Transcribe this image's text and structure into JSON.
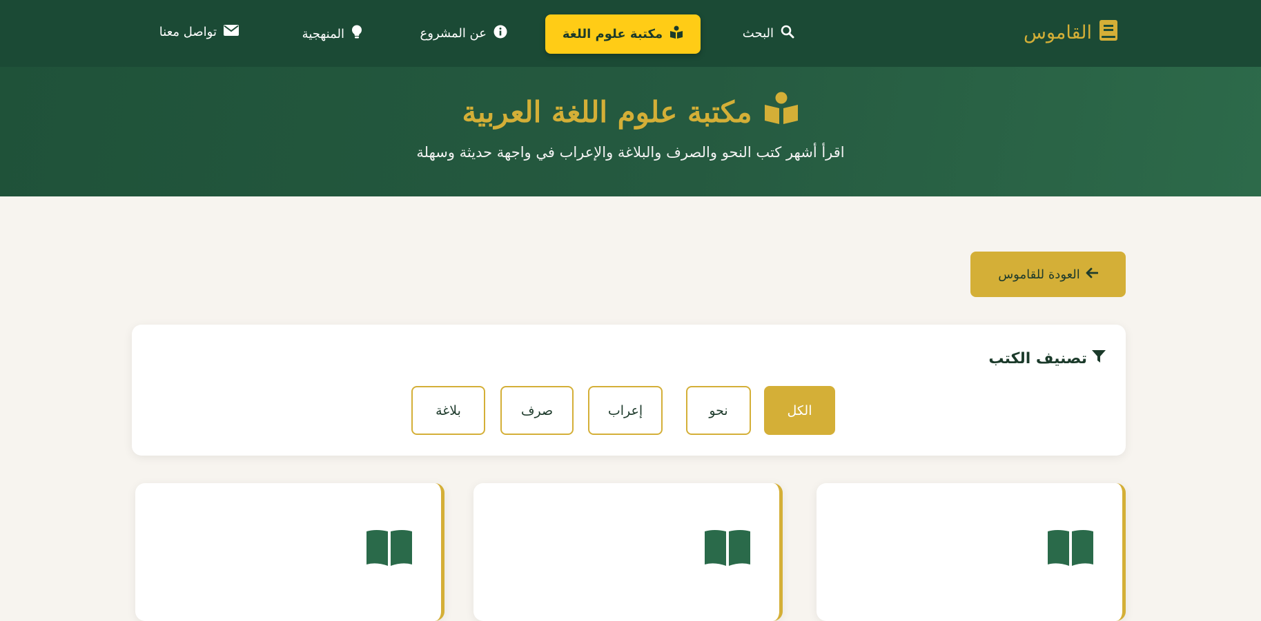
{
  "nav": {
    "brand": "القاموس",
    "items": [
      {
        "label": "البحث",
        "icon": "search-icon"
      },
      {
        "label": "مكتبة علوم اللغة",
        "icon": "book-reader-icon",
        "active": true
      },
      {
        "label": "عن المشروع",
        "icon": "info-icon"
      },
      {
        "label": "المنهجية",
        "icon": "lightbulb-icon"
      },
      {
        "label": "تواصل معنا",
        "icon": "envelope-icon"
      }
    ]
  },
  "hero": {
    "title": "مكتبة علوم اللغة العربية",
    "subtitle": "اقرأ أشهر كتب النحو والصرف والبلاغة والإعراب في واجهة حديثة وسهلة"
  },
  "back_button": {
    "label": "العودة للقاموس"
  },
  "filter": {
    "title": "تصنيف الكتب",
    "options": [
      "الكل",
      "نحو",
      "إعراب",
      "صرف",
      "بلاغة"
    ],
    "selected": "الكل"
  },
  "colors": {
    "primary_green": "#1b4a35",
    "gold": "#d4af37",
    "highlight_yellow": "#ffcc16",
    "background": "#f7f4ef"
  }
}
